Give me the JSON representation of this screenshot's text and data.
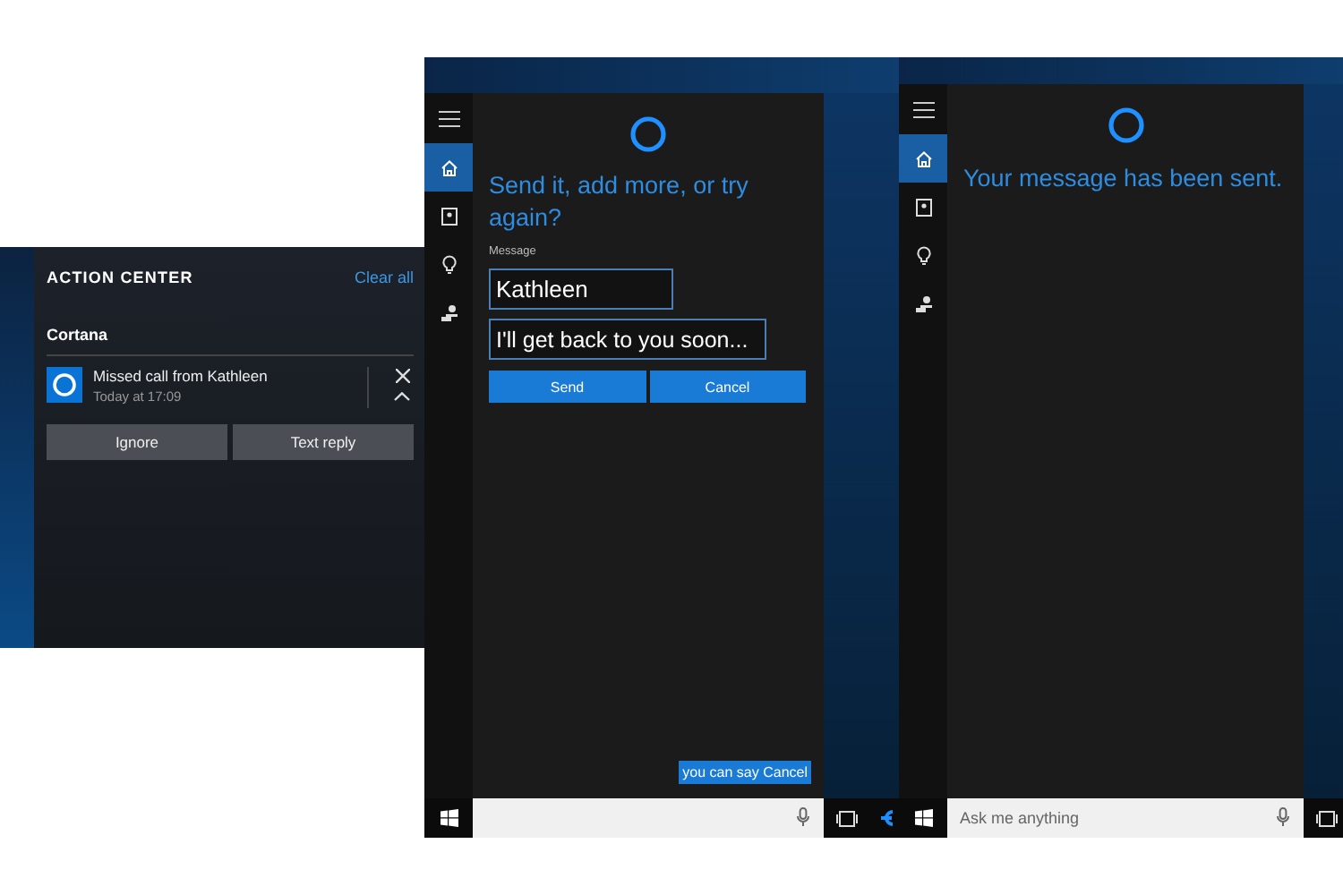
{
  "action_center": {
    "title": "ACTION CENTER",
    "clear_all": "Clear all",
    "group": "Cortana",
    "notification": {
      "title": "Missed call from Kathleen",
      "time": "Today at 17:09"
    },
    "buttons": [
      "Ignore",
      "Text reply"
    ]
  },
  "screens": [
    {
      "kind": "compose",
      "sidebar": [
        {
          "kind": "home",
          "selected": true
        },
        {
          "kind": "notebook",
          "selected": false
        },
        {
          "kind": "bulb",
          "selected": false
        },
        {
          "kind": "feedback",
          "selected": false
        }
      ],
      "heading": "Send it, add more, or try again?",
      "field_label": "Message",
      "fields": [
        "Kathleen",
        "I'll get back to you soon..."
      ],
      "buttons": [
        "Send",
        "Cancel"
      ],
      "tooltip": "you can say Cancel"
    },
    {
      "kind": "sent",
      "sidebar": [
        {
          "kind": "home",
          "selected": true
        },
        {
          "kind": "notebook",
          "selected": false
        },
        {
          "kind": "bulb",
          "selected": false
        },
        {
          "kind": "feedback",
          "selected": false
        }
      ],
      "heading": "Your message has been sent.",
      "search": {
        "placeholder": "Ask me anything"
      }
    }
  ]
}
